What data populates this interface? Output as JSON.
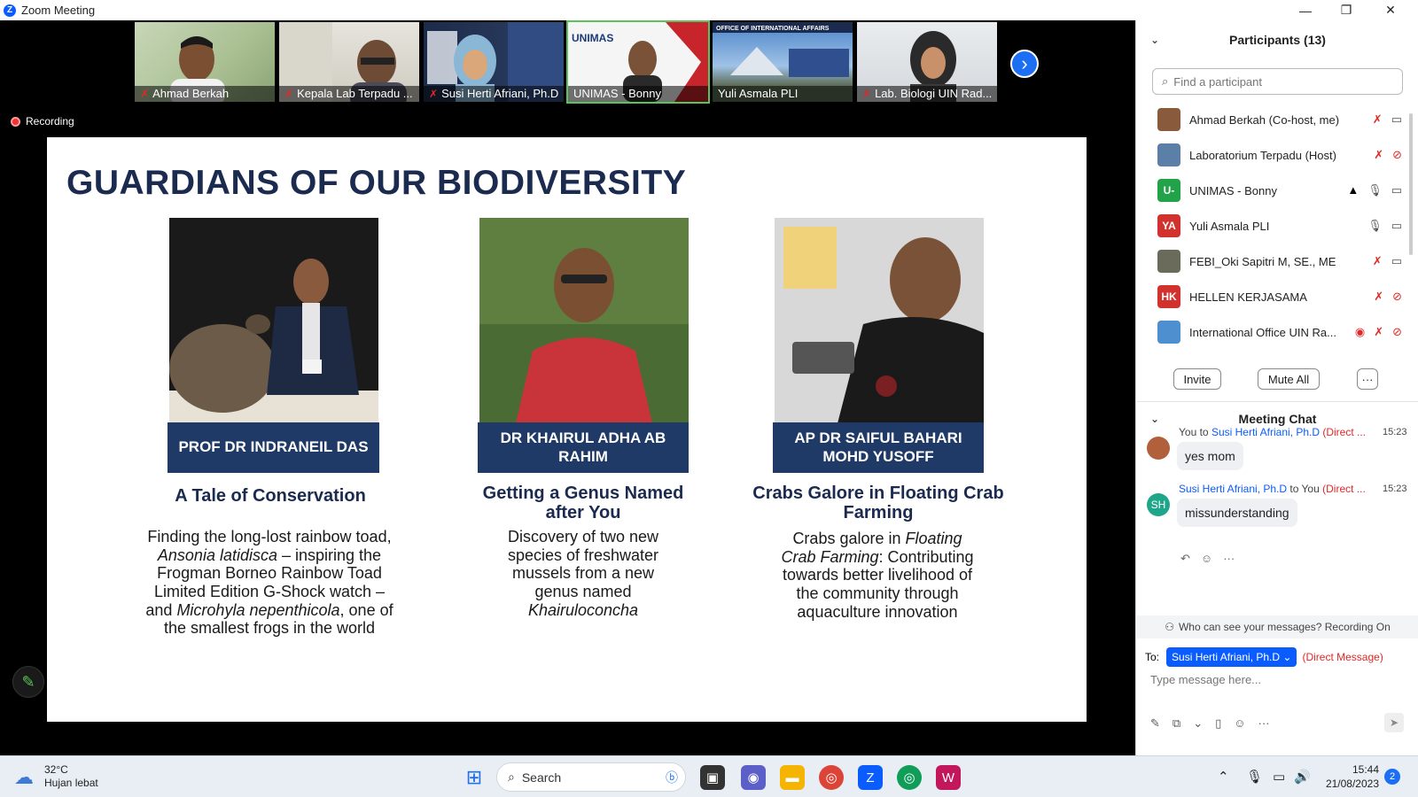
{
  "window": {
    "title": "Zoom Meeting",
    "minimize": "—",
    "maximize": "❐",
    "close": "✕"
  },
  "video_strip": {
    "tiles": [
      {
        "name": "Ahmad Berkah"
      },
      {
        "name": "Kepala Lab Terpadu ..."
      },
      {
        "name": "Susi Herti Afriani, Ph.D"
      },
      {
        "name": "UNIMAS - Bonny",
        "logo": "UNIMAS"
      },
      {
        "name": "Yuli Asmala PLI",
        "banner": "OFFICE OF INTERNATIONAL AFFAIRS"
      },
      {
        "name": "Lab. Biologi UIN Rad..."
      }
    ],
    "next_icon": "›"
  },
  "recording": {
    "label": "Recording"
  },
  "slide": {
    "title": "GUARDIANS OF OUR BIODIVERSITY",
    "columns": [
      {
        "nameplate": "PROF DR INDRANEIL DAS",
        "heading": "A Tale of Conservation",
        "body_lines": [
          {
            "parts": [
              {
                "t": "Finding the long-lost rainbow toad,"
              }
            ]
          },
          {
            "parts": [
              {
                "t": "Ansonia latidisca",
                "i": true
              },
              {
                "t": " – inspiring the"
              }
            ]
          },
          {
            "parts": [
              {
                "t": "Frogman Borneo Rainbow Toad"
              }
            ]
          },
          {
            "parts": [
              {
                "t": "Limited Edition G-Shock watch –"
              }
            ]
          },
          {
            "parts": [
              {
                "t": "and "
              },
              {
                "t": "Microhyla nepenthicola",
                "i": true
              },
              {
                "t": ", one of"
              }
            ]
          },
          {
            "parts": [
              {
                "t": "the smallest frogs in the world"
              }
            ]
          }
        ]
      },
      {
        "nameplate": "DR  KHAIRUL ADHA  AB RAHIM",
        "heading": "Getting a Genus Named after You",
        "body_lines": [
          {
            "parts": [
              {
                "t": "Discovery of two new"
              }
            ]
          },
          {
            "parts": [
              {
                "t": "species of freshwater"
              }
            ]
          },
          {
            "parts": [
              {
                "t": "mussels from a new"
              }
            ]
          },
          {
            "parts": [
              {
                "t": "genus named"
              }
            ]
          },
          {
            "parts": [
              {
                "t": "Khairuloconcha",
                "i": true
              }
            ]
          }
        ]
      },
      {
        "nameplate": "AP DR SAIFUL BAHARI MOHD YUSOFF",
        "heading": "Crabs Galore in Floating Crab Farming",
        "body_lines": [
          {
            "parts": [
              {
                "t": "Crabs galore in "
              },
              {
                "t": "Floating",
                "i": true
              }
            ]
          },
          {
            "parts": [
              {
                "t": "Crab Farming",
                "i": true
              },
              {
                "t": ": Contributing"
              }
            ]
          },
          {
            "parts": [
              {
                "t": "towards better livelihood of"
              }
            ]
          },
          {
            "parts": [
              {
                "t": "the community through"
              }
            ]
          },
          {
            "parts": [
              {
                "t": "aquaculture innovation"
              }
            ]
          }
        ]
      }
    ]
  },
  "annotate_button": {
    "icon": "pencil-icon",
    "glyph": "✎"
  },
  "participants": {
    "header": "Participants (13)",
    "search_placeholder": "Find a participant",
    "list": [
      {
        "name": "Ahmad Berkah (Co-host, me)",
        "initials": "",
        "avatar_color": "#8a5a3c",
        "mic": "muted",
        "video": "on"
      },
      {
        "name": "Laboratorium Terpadu (Host)",
        "initials": "",
        "avatar_color": "#5b7fa6",
        "mic": "muted",
        "video": "off"
      },
      {
        "name": "UNIMAS - Bonny",
        "initials": "U-",
        "avatar_color": "#22a34a",
        "mic": "on",
        "video": "on",
        "share": true
      },
      {
        "name": "Yuli Asmala PLI",
        "initials": "YA",
        "avatar_color": "#d2322d",
        "mic": "on",
        "video": "on"
      },
      {
        "name": "FEBI_Oki Sapitri M, SE., ME",
        "initials": "",
        "avatar_color": "#6b6b5b",
        "mic": "muted",
        "video": "on"
      },
      {
        "name": "HELLEN KERJASAMA",
        "initials": "HK",
        "avatar_color": "#d2322d",
        "mic": "muted",
        "video": "off"
      },
      {
        "name": "International Office UIN Ra...",
        "initials": "",
        "avatar_color": "#4d8fcf",
        "mic": "muted",
        "video": "off",
        "recording": true
      }
    ],
    "buttons": {
      "invite": "Invite",
      "mute_all": "Mute All",
      "more": "···"
    }
  },
  "chat": {
    "header": "Meeting Chat",
    "messages": [
      {
        "from": "You",
        "to_word": "to",
        "to": "Susi Herti Afriani, Ph.D",
        "tag": "(Direct ...",
        "time": "15:23",
        "text": "yes mom",
        "avatar": "",
        "avatar_color": "#b0603a"
      },
      {
        "from": "Susi Herti Afriani, Ph.D",
        "to_word": "to",
        "to": "You",
        "tag": "(Direct ...",
        "time": "15:23",
        "text": "missunderstanding",
        "avatar": "SH",
        "avatar_color": "#1ea58a"
      }
    ],
    "notice": "Who can see your messages? Recording On",
    "to_label": "To:",
    "to_recipient": "Susi Herti Afriani, Ph.D",
    "to_tag": "(Direct Message)",
    "input_placeholder": "Type message here..."
  },
  "taskbar": {
    "weather_temp": "32°C",
    "weather_desc": "Hujan lebat",
    "search_label": "Search",
    "time": "15:44",
    "date": "21/08/2023",
    "notifications": "2"
  }
}
